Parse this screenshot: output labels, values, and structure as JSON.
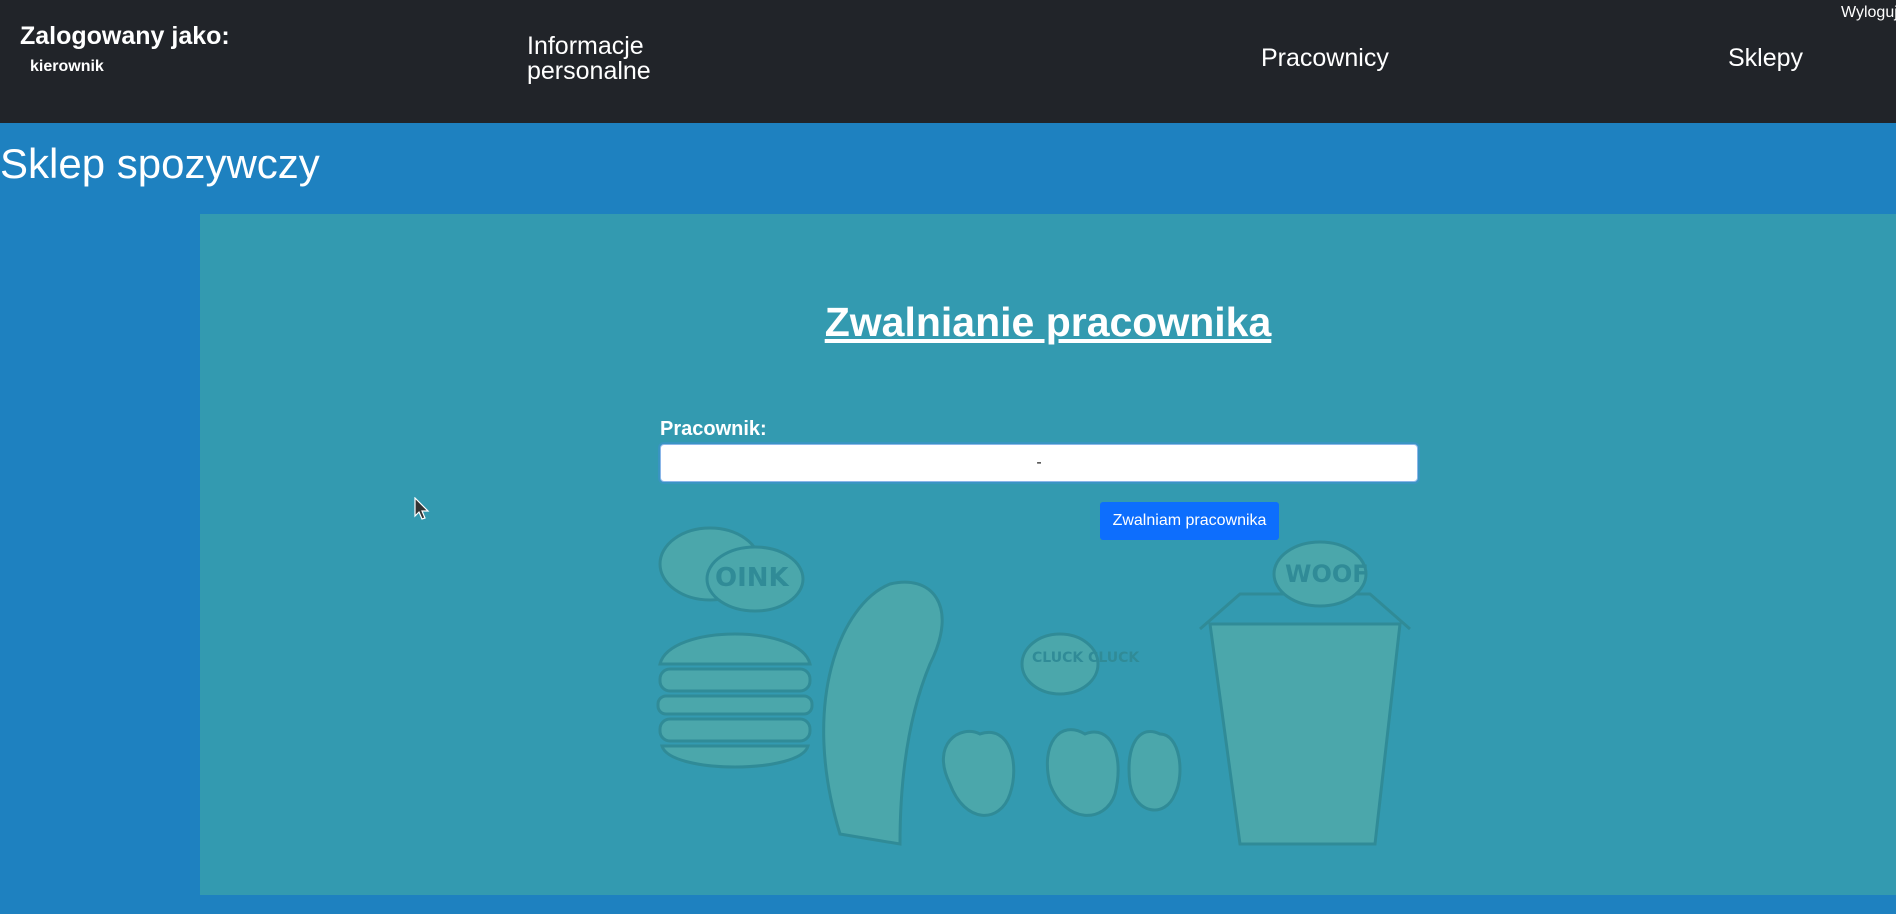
{
  "header": {
    "logged_as_label": "Zalogowany jako:",
    "username": "kierownik",
    "nav": {
      "personal_info": "Informacje personalne",
      "workers": "Pracownicy",
      "shops": "Sklepy"
    },
    "logout": "Wyloguj"
  },
  "app": {
    "title": "Sklep spozywczy"
  },
  "form": {
    "heading": "Zwalnianie pracownika",
    "employee_label": "Pracownik:",
    "employee_selected": "-",
    "submit_label": "Zwalniam pracownika"
  },
  "illustration": {
    "bubble_oink": "OINK",
    "bubble_woof": "WOOF",
    "bubble_cluck": "CLUCK CLUCK"
  },
  "colors": {
    "topbar": "#212429",
    "page_bg": "#1e81c0",
    "panel_bg": "#339ab0",
    "button": "#0d6efd"
  },
  "icons": [
    "mouse-cursor-icon"
  ]
}
